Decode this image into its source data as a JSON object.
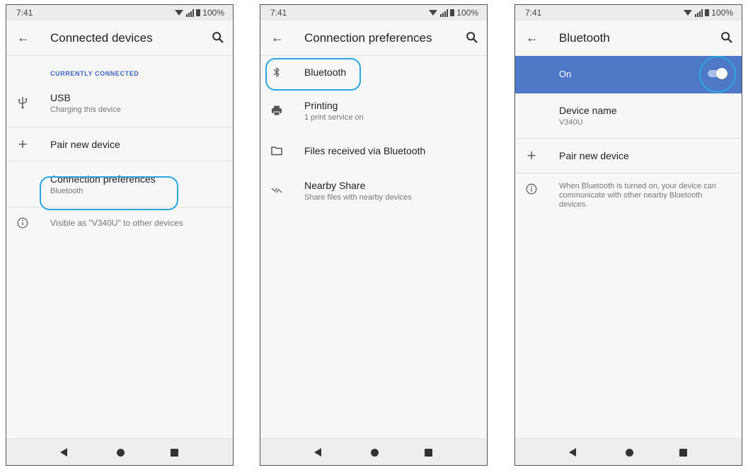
{
  "accent_color": "#29a7de",
  "on_bar_color": "#4f79c7",
  "section_label_color": "#3f63c1",
  "screens": [
    {
      "status": {
        "time": "7:41",
        "battery": "100%"
      },
      "title": "Connected devices",
      "section_label": "CURRENTLY CONNECTED",
      "usb": {
        "icon": "usb-icon",
        "primary": "USB",
        "secondary": "Charging this device"
      },
      "pair": {
        "icon": "plus-icon",
        "primary": "Pair new device"
      },
      "connpref": {
        "primary": "Connection preferences",
        "secondary": "Bluetooth"
      },
      "visible": {
        "icon": "info-icon",
        "text": "Visible as \"V340U\" to other devices"
      }
    },
    {
      "status": {
        "time": "7:41",
        "battery": "100%"
      },
      "title": "Connection preferences",
      "items": [
        {
          "icon": "bluetooth-icon",
          "primary": "Bluetooth"
        },
        {
          "icon": "printer-icon",
          "primary": "Printing",
          "secondary": "1 print service on"
        },
        {
          "icon": "folder-icon",
          "primary": "Files received via Bluetooth"
        },
        {
          "icon": "nearby-share-icon",
          "primary": "Nearby Share",
          "secondary": "Share files with nearby devices"
        }
      ]
    },
    {
      "status": {
        "time": "7:41",
        "battery": "100%"
      },
      "title": "Bluetooth",
      "on_label": "On",
      "toggle_state": "on",
      "device_name": {
        "primary": "Device name",
        "secondary": "V340U"
      },
      "pair": {
        "icon": "plus-icon",
        "primary": "Pair new device"
      },
      "info": {
        "icon": "info-icon",
        "text": "When Bluetooth is turned on, your device can communicate with other nearby Bluetooth devices."
      }
    }
  ]
}
